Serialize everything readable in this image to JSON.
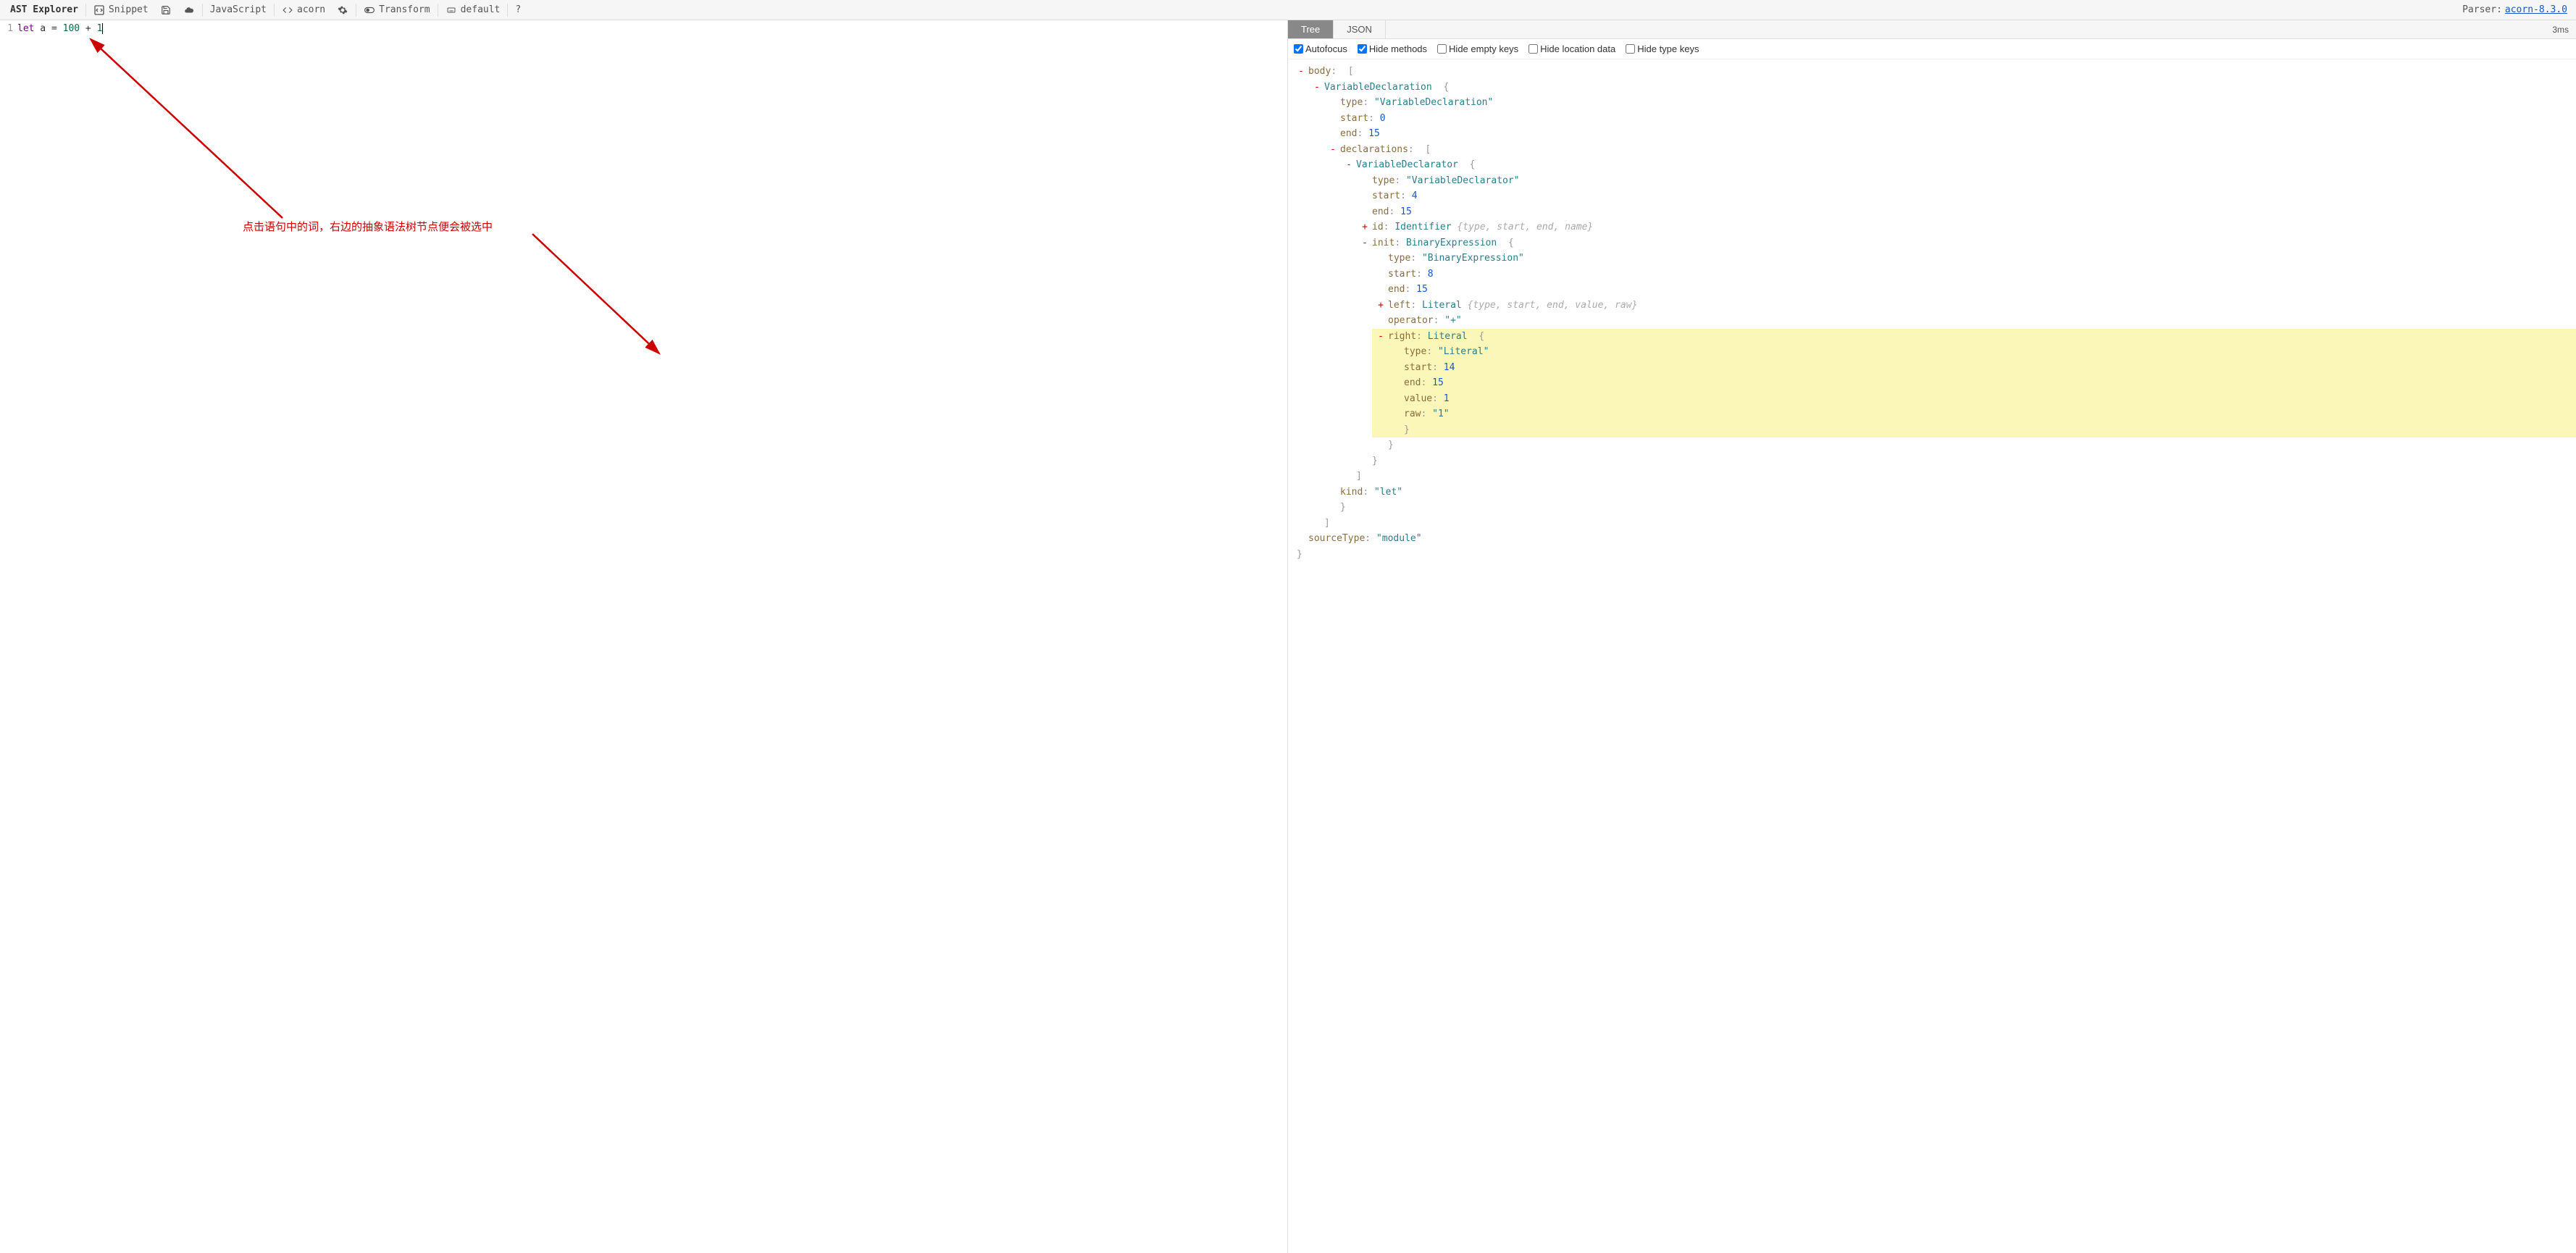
{
  "toolbar": {
    "brand": "AST Explorer",
    "snippet": "Snippet",
    "language": "JavaScript",
    "parser": "acorn",
    "transform": "Transform",
    "default": "default",
    "help": "?",
    "parser_label": "Parser: ",
    "parser_link": "acorn-8.3.0"
  },
  "code": {
    "line_no": "1",
    "tok_let": "let",
    "tok_a": " a ",
    "tok_eq": "= ",
    "tok_100": "100",
    "tok_plus": " + ",
    "tok_1": "1"
  },
  "annot": {
    "text": "点击语句中的词，右边的抽象语法树节点便会被选中"
  },
  "tabs": {
    "tree": "Tree",
    "json": "JSON",
    "timing": "3ms"
  },
  "options": {
    "autofocus": "Autofocus",
    "hide_methods": "Hide methods",
    "hide_empty": "Hide empty keys",
    "hide_location": "Hide location data",
    "hide_type": "Hide type keys"
  },
  "tree": {
    "body_key": "body",
    "vd_name": "VariableDeclaration",
    "type_key": "type",
    "vd_type_val": "\"VariableDeclaration\"",
    "start_key": "start",
    "end_key": "end",
    "vd_start": "0",
    "vd_end": "15",
    "declarations_key": "declarations",
    "vr_name": "VariableDeclarator",
    "vr_type_val": "\"VariableDeclarator\"",
    "vr_start": "4",
    "vr_end": "15",
    "id_key": "id",
    "id_name": "Identifier",
    "id_summary": "{type, start, end, name}",
    "init_key": "init",
    "be_name": "BinaryExpression",
    "be_type_val": "\"BinaryExpression\"",
    "be_start": "8",
    "be_end": "15",
    "left_key": "left",
    "left_name": "Literal",
    "left_summary": "{type, start, end, value, raw}",
    "operator_key": "operator",
    "operator_val": "\"+\"",
    "right_key": "right",
    "right_name": "Literal",
    "lit_type_val": "\"Literal\"",
    "lit_start": "14",
    "lit_end": "15",
    "value_key": "value",
    "lit_value": "1",
    "raw_key": "raw",
    "lit_raw": "\"1\"",
    "kind_key": "kind",
    "kind_val": "\"let\"",
    "sourceType_key": "sourceType",
    "sourceType_val": "\"module\"",
    "open_brace": "{",
    "close_brace": "}",
    "open_bracket": "[",
    "close_bracket": "]",
    "colon": ": ",
    "minus": "-",
    "plus": "+"
  }
}
